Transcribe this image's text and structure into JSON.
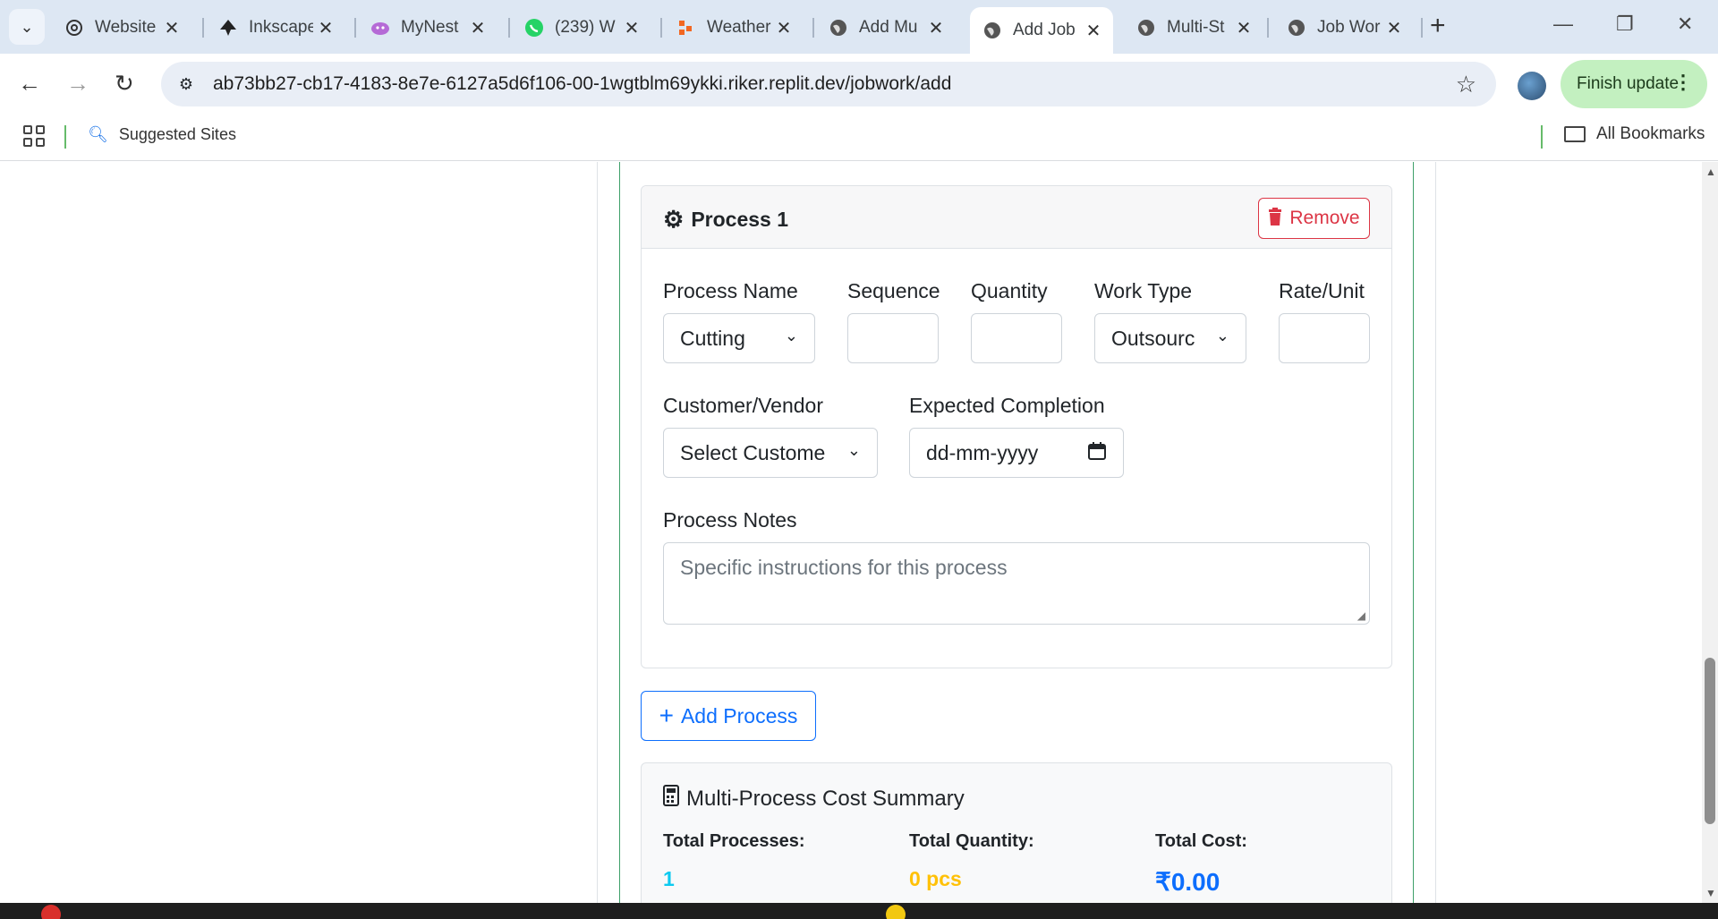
{
  "browser": {
    "tabs": [
      {
        "title": "Website",
        "icon": "openai-icon"
      },
      {
        "title": "Inkscape",
        "icon": "inkscape-icon"
      },
      {
        "title": "MyNest",
        "icon": "mynest-icon"
      },
      {
        "title": "(239) W",
        "icon": "whatsapp-icon"
      },
      {
        "title": "Weather",
        "icon": "weather-icon"
      },
      {
        "title": "Add Mu",
        "icon": "globe-icon"
      },
      {
        "title": "Add Job",
        "icon": "globe-icon"
      },
      {
        "title": "Multi-St",
        "icon": "globe-icon"
      },
      {
        "title": "Job Wor",
        "icon": "globe-icon"
      }
    ],
    "url": "ab73bb27-cb17-4183-8e7e-6127a5d6f106-00-1wgtblm69ykki.riker.replit.dev/jobwork/add",
    "finish_update": "Finish update",
    "bookmarks": {
      "suggested": "Suggested Sites",
      "all": "All Bookmarks"
    }
  },
  "process": {
    "title": "Process 1",
    "remove_label": "Remove",
    "fields": {
      "process_name_label": "Process Name",
      "process_name_value": "Cutting",
      "sequence_label": "Sequence",
      "sequence_value": "",
      "quantity_label": "Quantity",
      "quantity_value": "",
      "work_type_label": "Work Type",
      "work_type_value": "Outsourc",
      "rate_label": "Rate/Unit",
      "rate_value": "",
      "customer_label": "Customer/Vendor",
      "customer_value": "Select Custome",
      "completion_label": "Expected Completion",
      "completion_placeholder": "dd-mm-yyyy",
      "notes_label": "Process Notes",
      "notes_placeholder": "Specific instructions for this process"
    }
  },
  "add_process_label": "Add Process",
  "summary": {
    "title": "Multi-Process Cost Summary",
    "total_processes_label": "Total Processes:",
    "total_processes_value": "1",
    "total_quantity_label": "Total Quantity:",
    "total_quantity_value": "0 pcs",
    "total_cost_label": "Total Cost:",
    "total_cost_value": "₹0.00"
  },
  "colors": {
    "danger": "#dc3545",
    "primary": "#0d6efd",
    "info": "#0dcaf0",
    "warning": "#ffc107",
    "card_border": "#3fa06a"
  }
}
